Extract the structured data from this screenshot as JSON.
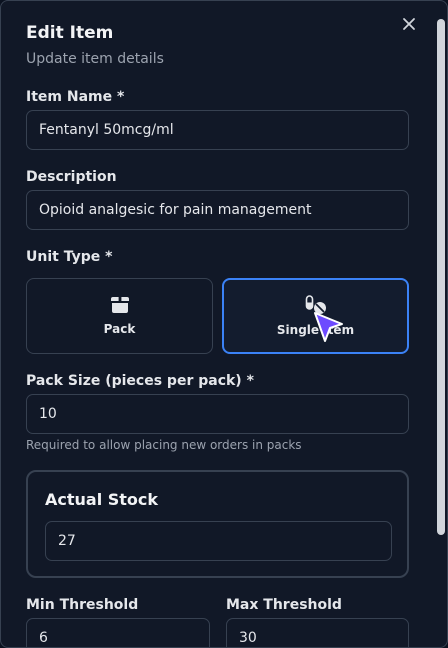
{
  "modal": {
    "title": "Edit Item",
    "subtitle": "Update item details"
  },
  "fields": {
    "item_name": {
      "label": "Item Name *",
      "value": "Fentanyl 50mcg/ml"
    },
    "description": {
      "label": "Description",
      "value": "Opioid analgesic for pain management"
    },
    "unit_type": {
      "label": "Unit Type *",
      "options": [
        {
          "label": "Pack",
          "icon": "box-icon",
          "selected": false
        },
        {
          "label": "Single Item",
          "icon": "pill-icon",
          "selected": true
        }
      ]
    },
    "pack_size": {
      "label": "Pack Size (pieces per pack) *",
      "value": "10",
      "hint": "Required to allow placing new orders in packs"
    },
    "actual_stock": {
      "label": "Actual Stock",
      "value": "27"
    },
    "min_threshold": {
      "label": "Min Threshold",
      "value": "6"
    },
    "max_threshold": {
      "label": "Max Threshold",
      "value": "30"
    }
  },
  "colors": {
    "background": "#111827",
    "border": "#374151",
    "accent": "#3b82f6",
    "cursor": "#6d4aff"
  }
}
